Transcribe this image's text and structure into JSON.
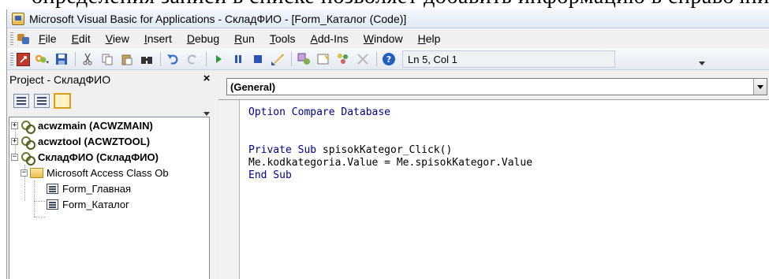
{
  "caption": {
    "text": "определения записи в списке позволяет добавить информацию в справочник"
  },
  "window": {
    "title": "Microsoft Visual Basic for Applications - СкладФИО - [Form_Каталог (Code)]"
  },
  "menubar": {
    "items": [
      {
        "underline": "F",
        "rest": "ile"
      },
      {
        "underline": "E",
        "rest": "dit"
      },
      {
        "underline": "V",
        "rest": "iew"
      },
      {
        "underline": "I",
        "rest": "nsert"
      },
      {
        "underline": "D",
        "rest": "ebug"
      },
      {
        "underline": "R",
        "rest": "un"
      },
      {
        "underline": "T",
        "rest": "ools"
      },
      {
        "underline": "A",
        "rest": "dd-Ins"
      },
      {
        "underline": "W",
        "rest": "indow"
      },
      {
        "underline": "H",
        "rest": "elp"
      }
    ]
  },
  "toolbar": {
    "cursor_position": "Ln 5, Col 1",
    "icons": [
      "access-view-icon",
      "insert-module-icon",
      "save-icon",
      "cut-icon",
      "copy-icon",
      "paste-icon",
      "find-icon",
      "undo-icon",
      "redo-icon",
      "run-icon",
      "break-icon",
      "reset-icon",
      "design-mode-icon",
      "project-explorer-icon",
      "properties-icon",
      "object-browser-icon",
      "toolbox-icon",
      "help-icon"
    ]
  },
  "project_panel": {
    "title": "Project - СкладФИО",
    "tree": {
      "projects": [
        {
          "label": "acwzmain (ACWZMAIN)",
          "expander": "+"
        },
        {
          "label": "acwztool (ACWZTOOL)",
          "expander": "+"
        },
        {
          "label": "СкладФИО (СкладФИО)",
          "expander": "−"
        }
      ],
      "folder": {
        "label": "Microsoft Access Class Ob",
        "expander": "−"
      },
      "forms": [
        {
          "label": "Form_Главная"
        },
        {
          "label": "Form_Каталог"
        }
      ]
    }
  },
  "code_window": {
    "object_selector": "(General)",
    "lines": {
      "line1": "Option Compare Database",
      "line3_kw": "Private Sub",
      "line3_rest": " spisokKategor_Click()",
      "line4": "Me.kodkategoria.Value = Me.spisokKategor.Value",
      "line5": "End Sub"
    }
  },
  "colors": {
    "keyword": "#00008b",
    "window_bg": "#f0f0f0",
    "title_gradient": "#dfe9f5"
  }
}
